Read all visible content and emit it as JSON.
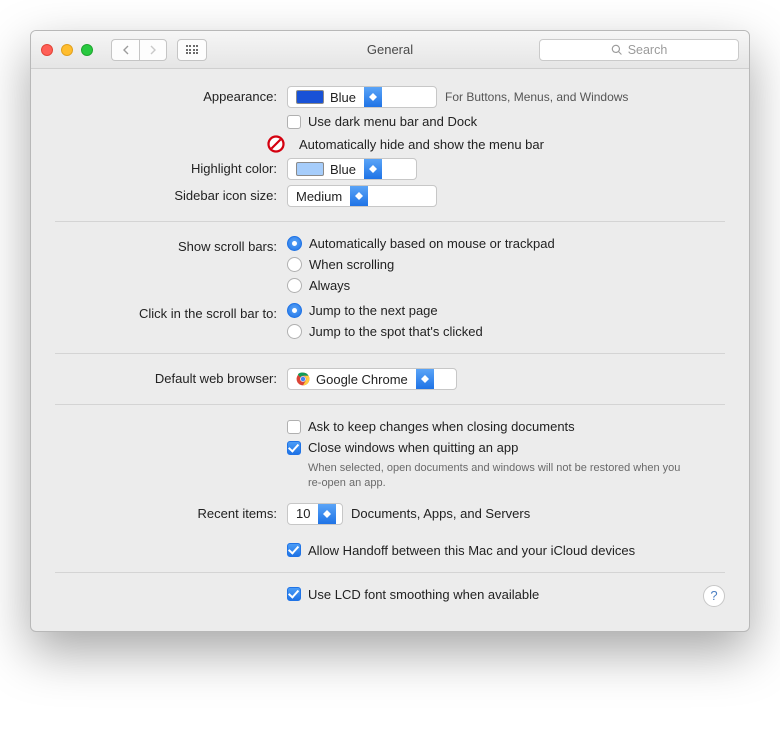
{
  "title": "General",
  "search_placeholder": "Search",
  "labels": {
    "appearance": "Appearance:",
    "highlight": "Highlight color:",
    "sidebar_icon": "Sidebar icon size:",
    "scrollbars": "Show scroll bars:",
    "click_scroll": "Click in the scroll bar to:",
    "browser": "Default web browser:",
    "recent": "Recent items:"
  },
  "appearance": {
    "value": "Blue",
    "hint": "For Buttons, Menus, and Windows",
    "dark_menu": "Use dark menu bar and Dock",
    "autohide": "Automatically hide and show the menu bar"
  },
  "highlight": {
    "value": "Blue"
  },
  "sidebar_icon": {
    "value": "Medium"
  },
  "scrollbars": {
    "opt_auto": "Automatically based on mouse or trackpad",
    "opt_scroll": "When scrolling",
    "opt_always": "Always"
  },
  "click_scroll": {
    "opt_next": "Jump to the next page",
    "opt_spot": "Jump to the spot that's clicked"
  },
  "browser": {
    "value": "Google Chrome"
  },
  "docs": {
    "ask": "Ask to keep changes when closing documents",
    "close": "Close windows when quitting an app",
    "close_help": "When selected, open documents and windows will not be restored when you re-open an app."
  },
  "recent": {
    "value": "10",
    "hint": "Documents, Apps, and Servers"
  },
  "handoff": "Allow Handoff between this Mac and your iCloud devices",
  "lcd": "Use LCD font smoothing when available"
}
